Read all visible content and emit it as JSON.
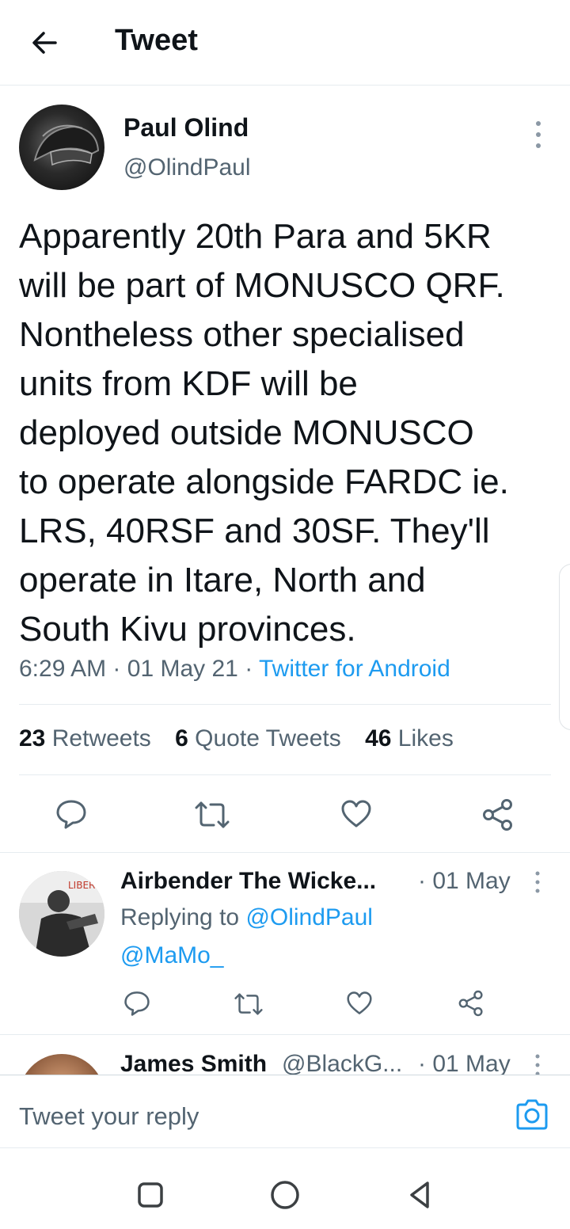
{
  "header": {
    "title": "Tweet"
  },
  "tweet": {
    "author_name": "Paul Olind",
    "author_handle": "@OlindPaul",
    "text": "Apparently 20th Para and 5KR\nwill be part of MONUSCO QRF.\nNontheless other specialised\nunits from KDF will be\ndeployed outside MONUSCO\nto operate alongside FARDC ie.\nLRS, 40RSF and 30SF. They'll\noperate in Itare, North and\nSouth Kivu provinces.",
    "time": "6:29 AM",
    "date": "01 May 21",
    "source": "Twitter for Android",
    "stats": {
      "retweets_count": "23",
      "retweets_label": "Retweets",
      "quotes_count": "6",
      "quotes_label": "Quote Tweets",
      "likes_count": "46",
      "likes_label": "Likes"
    }
  },
  "replies": [
    {
      "name": "Airbender The Wicke...",
      "date": "· 01 May",
      "replying_label": "Replying to",
      "replying_to": "@OlindPaul",
      "mention": "@MaMo_"
    },
    {
      "name": "James Smith",
      "handle": "@BlackG...",
      "date": "· 01 May"
    }
  ],
  "compose": {
    "placeholder": "Tweet your reply"
  },
  "colors": {
    "accent": "#1d9bf0",
    "secondary_text": "#536471",
    "border": "#e6ecf0"
  }
}
